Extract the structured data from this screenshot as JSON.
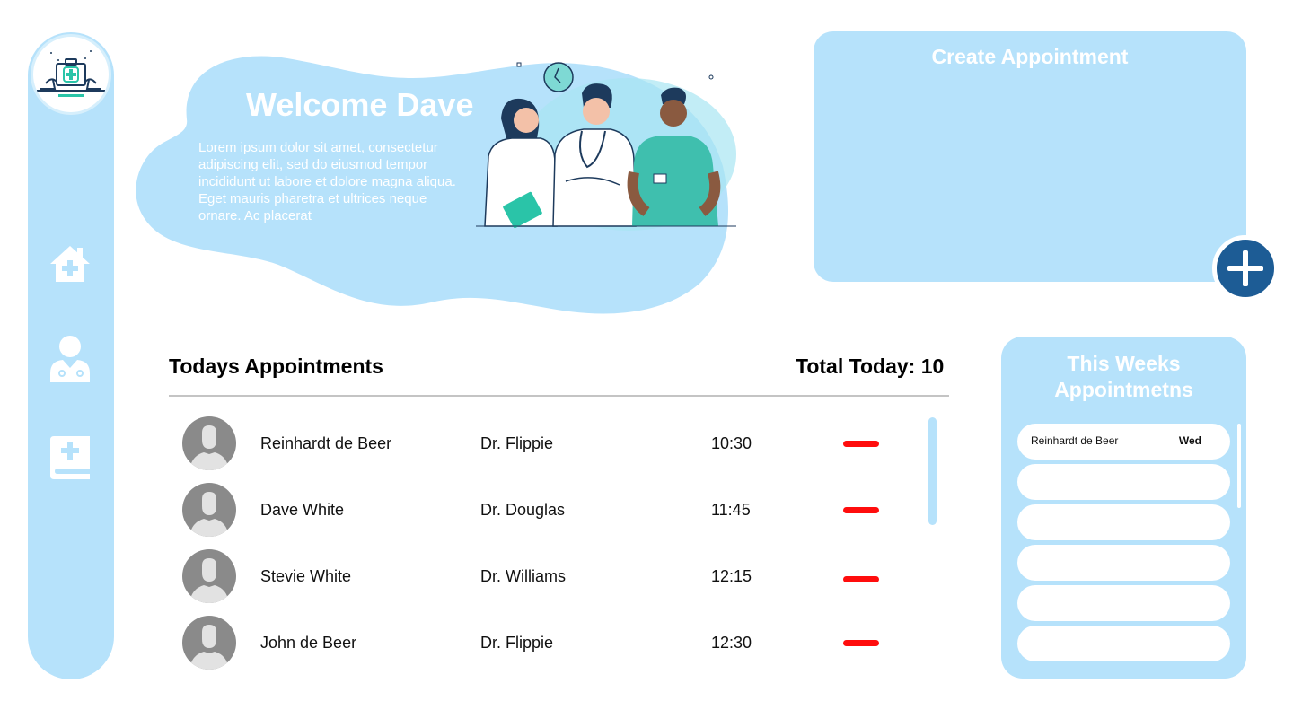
{
  "welcome": {
    "title": "Welcome Dave",
    "text": "Lorem ipsum dolor sit amet, consectetur adipiscing elit, sed do eiusmod tempor incididunt ut labore et dolore magna aliqua. Eget mauris pharetra et ultrices neque ornare. Ac placerat"
  },
  "sidebar": {
    "items": [
      {
        "icon": "home-plus-icon"
      },
      {
        "icon": "doctor-icon"
      },
      {
        "icon": "medical-book-icon"
      }
    ]
  },
  "create": {
    "title": "Create Appointment",
    "add_icon": "plus-icon"
  },
  "today": {
    "title": "Todays Appointments",
    "total": "Total Today: 10",
    "appointments": [
      {
        "name": "Reinhardt de Beer",
        "doctor": "Dr. Flippie",
        "time": "10:30"
      },
      {
        "name": "Dave White",
        "doctor": "Dr. Douglas",
        "time": "11:45"
      },
      {
        "name": "Stevie White",
        "doctor": "Dr. Williams",
        "time": "12:15"
      },
      {
        "name": "John de Beer",
        "doctor": "Dr. Flippie",
        "time": "12:30"
      }
    ]
  },
  "week": {
    "title": "This Weeks Appointmetns",
    "items": [
      {
        "name": "Reinhardt de Beer",
        "day": "Wed"
      },
      {
        "name": "",
        "day": ""
      },
      {
        "name": "",
        "day": ""
      },
      {
        "name": "",
        "day": ""
      },
      {
        "name": "",
        "day": ""
      },
      {
        "name": "",
        "day": ""
      }
    ]
  },
  "colors": {
    "panel": "#b6e2fb",
    "accent": "#1d5c95",
    "remove": "#ff0d0d",
    "avatar": "#8a8a8a"
  }
}
